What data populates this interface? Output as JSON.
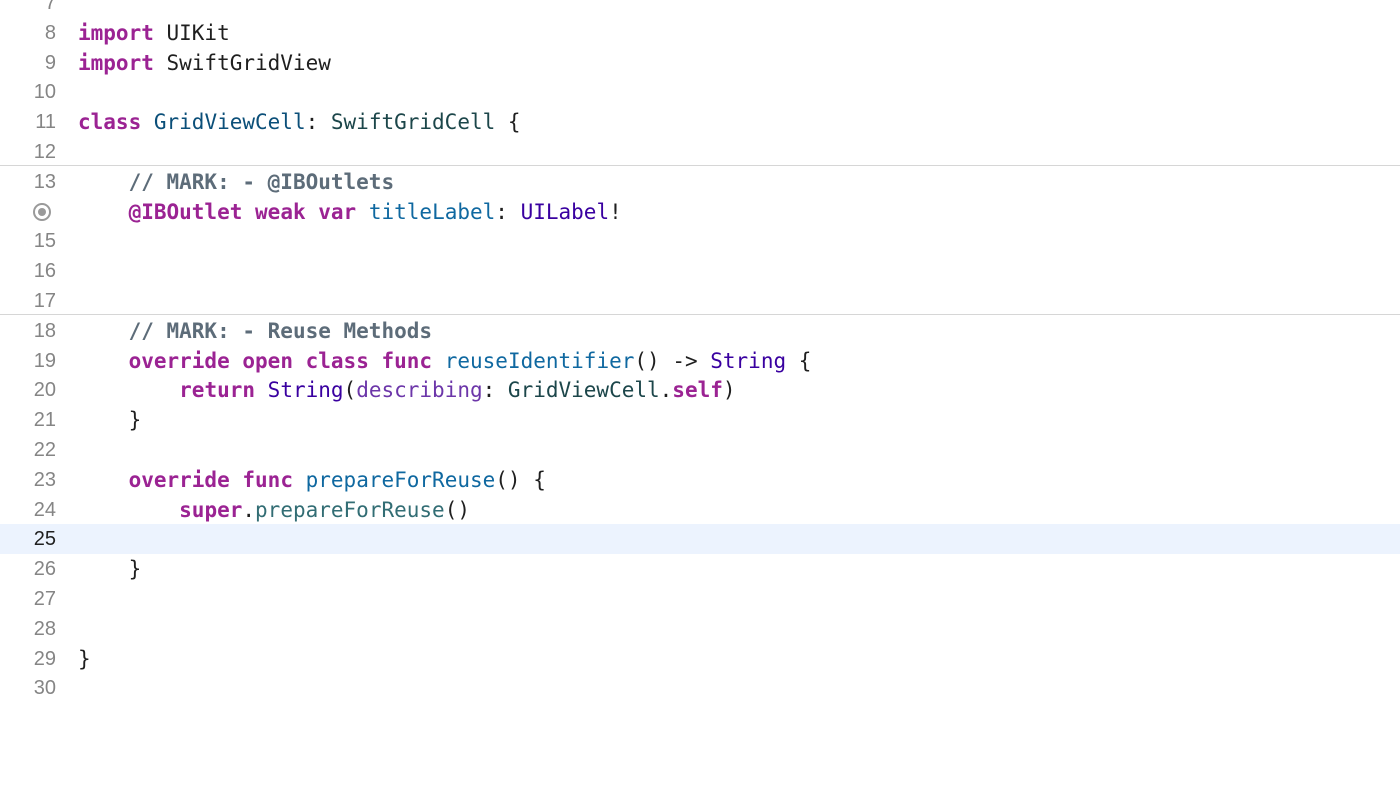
{
  "editor": {
    "current_line": "25",
    "lines": [
      {
        "num": "7",
        "tokens": []
      },
      {
        "num": "8",
        "tokens": [
          {
            "t": "import",
            "c": "kw"
          },
          {
            "t": " UIKit",
            "c": "plain"
          }
        ]
      },
      {
        "num": "9",
        "tokens": [
          {
            "t": "import",
            "c": "kw"
          },
          {
            "t": " SwiftGridView",
            "c": "plain"
          }
        ]
      },
      {
        "num": "10",
        "tokens": []
      },
      {
        "num": "11",
        "tokens": [
          {
            "t": "class",
            "c": "kw"
          },
          {
            "t": " ",
            "c": "plain"
          },
          {
            "t": "GridViewCell",
            "c": "type-decl"
          },
          {
            "t": ": ",
            "c": "plain"
          },
          {
            "t": "SwiftGridCell",
            "c": "type-proj"
          },
          {
            "t": " {",
            "c": "plain"
          }
        ]
      },
      {
        "num": "12",
        "tokens": []
      },
      {
        "num": "13",
        "mark": true,
        "tokens": [
          {
            "t": "    ",
            "c": "plain"
          },
          {
            "t": "// MARK: - @IBOutlets",
            "c": "comment-mark"
          }
        ]
      },
      {
        "num": "",
        "outlet": true,
        "tokens": [
          {
            "t": "    ",
            "c": "plain"
          },
          {
            "t": "@IBOutlet",
            "c": "kw"
          },
          {
            "t": " ",
            "c": "plain"
          },
          {
            "t": "weak",
            "c": "kw"
          },
          {
            "t": " ",
            "c": "plain"
          },
          {
            "t": "var",
            "c": "kw"
          },
          {
            "t": " ",
            "c": "plain"
          },
          {
            "t": "titleLabel",
            "c": "ident"
          },
          {
            "t": ": ",
            "c": "plain"
          },
          {
            "t": "UILabel",
            "c": "type-sys"
          },
          {
            "t": "!",
            "c": "plain"
          }
        ]
      },
      {
        "num": "15",
        "tokens": []
      },
      {
        "num": "16",
        "tokens": []
      },
      {
        "num": "17",
        "tokens": []
      },
      {
        "num": "18",
        "mark": true,
        "tokens": [
          {
            "t": "    ",
            "c": "plain"
          },
          {
            "t": "// MARK: - Reuse Methods",
            "c": "comment-mark"
          }
        ]
      },
      {
        "num": "19",
        "tokens": [
          {
            "t": "    ",
            "c": "plain"
          },
          {
            "t": "override",
            "c": "kw"
          },
          {
            "t": " ",
            "c": "plain"
          },
          {
            "t": "open",
            "c": "kw"
          },
          {
            "t": " ",
            "c": "plain"
          },
          {
            "t": "class",
            "c": "kw"
          },
          {
            "t": " ",
            "c": "plain"
          },
          {
            "t": "func",
            "c": "kw"
          },
          {
            "t": " ",
            "c": "plain"
          },
          {
            "t": "reuseIdentifier",
            "c": "ident"
          },
          {
            "t": "() -> ",
            "c": "plain"
          },
          {
            "t": "String",
            "c": "type-sys"
          },
          {
            "t": " {",
            "c": "plain"
          }
        ]
      },
      {
        "num": "20",
        "tokens": [
          {
            "t": "        ",
            "c": "plain"
          },
          {
            "t": "return",
            "c": "kw"
          },
          {
            "t": " ",
            "c": "plain"
          },
          {
            "t": "String",
            "c": "type-sys"
          },
          {
            "t": "(",
            "c": "plain"
          },
          {
            "t": "describing",
            "c": "method-sys"
          },
          {
            "t": ": ",
            "c": "plain"
          },
          {
            "t": "GridViewCell",
            "c": "type-proj"
          },
          {
            "t": ".",
            "c": "plain"
          },
          {
            "t": "self",
            "c": "kw"
          },
          {
            "t": ")",
            "c": "plain"
          }
        ]
      },
      {
        "num": "21",
        "tokens": [
          {
            "t": "    }",
            "c": "plain"
          }
        ]
      },
      {
        "num": "22",
        "tokens": []
      },
      {
        "num": "23",
        "tokens": [
          {
            "t": "    ",
            "c": "plain"
          },
          {
            "t": "override",
            "c": "kw"
          },
          {
            "t": " ",
            "c": "plain"
          },
          {
            "t": "func",
            "c": "kw"
          },
          {
            "t": " ",
            "c": "plain"
          },
          {
            "t": "prepareForReuse",
            "c": "ident"
          },
          {
            "t": "() {",
            "c": "plain"
          }
        ]
      },
      {
        "num": "24",
        "tokens": [
          {
            "t": "        ",
            "c": "plain"
          },
          {
            "t": "super",
            "c": "kw"
          },
          {
            "t": ".",
            "c": "plain"
          },
          {
            "t": "prepareForReuse",
            "c": "method-proj"
          },
          {
            "t": "()",
            "c": "plain"
          }
        ]
      },
      {
        "num": "25",
        "tokens": []
      },
      {
        "num": "26",
        "tokens": [
          {
            "t": "    }",
            "c": "plain"
          }
        ]
      },
      {
        "num": "27",
        "tokens": []
      },
      {
        "num": "28",
        "tokens": []
      },
      {
        "num": "29",
        "tokens": [
          {
            "t": "}",
            "c": "plain"
          }
        ]
      },
      {
        "num": "30",
        "tokens": []
      }
    ]
  },
  "colors": {
    "keyword": "#9b2393",
    "type_declaration": "#0b4f79",
    "type_project": "#1c464a",
    "type_system": "#3900a0",
    "identifier": "#0f68a0",
    "method_project": "#326d74",
    "method_system": "#6c36a9",
    "comment_mark": "#5d6c79",
    "plain_text": "#1f1f1f",
    "line_number": "#858585",
    "current_line_highlight": "#ecf3fe",
    "mark_separator": "#d6d6d6"
  },
  "icons": {
    "outlet_connection": "outlet-connection-icon"
  }
}
